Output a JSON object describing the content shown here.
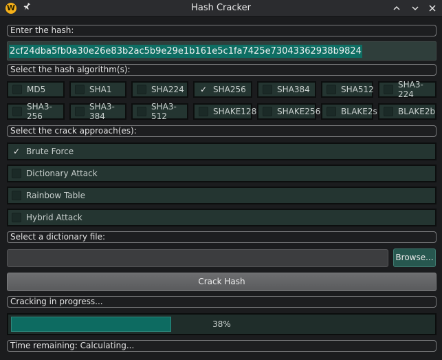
{
  "window": {
    "title": "Hash Cracker",
    "logo_letter": "W"
  },
  "hash_section": {
    "label": "Enter the hash:",
    "value": "2cf24dba5fb0a30e26e83b2ac5b9e29e1b161e5c1fa7425e73043362938b9824"
  },
  "algo_section": {
    "label": "Select the hash algorithm(s):",
    "row1": [
      {
        "label": "MD5",
        "checked": false
      },
      {
        "label": "SHA1",
        "checked": false
      },
      {
        "label": "SHA224",
        "checked": false
      },
      {
        "label": "SHA256",
        "checked": true
      },
      {
        "label": "SHA384",
        "checked": false
      },
      {
        "label": "SHA512",
        "checked": false
      },
      {
        "label": "SHA3-224",
        "checked": false
      }
    ],
    "row2": [
      {
        "label": "SHA3-256",
        "checked": false
      },
      {
        "label": "SHA3-384",
        "checked": false
      },
      {
        "label": "SHA3-512",
        "checked": false
      },
      {
        "label": "SHAKE128",
        "checked": false
      },
      {
        "label": "SHAKE256",
        "checked": false
      },
      {
        "label": "BLAKE2s",
        "checked": false
      },
      {
        "label": "BLAKE2b",
        "checked": false
      }
    ]
  },
  "approach_section": {
    "label": "Select the crack approach(es):",
    "items": [
      {
        "label": "Brute Force",
        "checked": true
      },
      {
        "label": "Dictionary Attack",
        "checked": false
      },
      {
        "label": "Rainbow Table",
        "checked": false
      },
      {
        "label": "Hybrid Attack",
        "checked": false
      }
    ]
  },
  "dictionary": {
    "label": "Select a dictionary file:",
    "value": "",
    "browse_label": "Browse..."
  },
  "crack_button_label": "Crack Hash",
  "status": {
    "progress_label": "Cracking in progress...",
    "progress_value": 0.38,
    "progress_text": "38%",
    "time_remaining": "Time remaining: Calculating..."
  },
  "colors": {
    "accent": "#0d6b61",
    "panel": "#243531",
    "logo": "#f5b019"
  },
  "icons": {
    "logo": "app-logo-icon",
    "pin": "pin-icon",
    "minimize": "chevron-up-icon",
    "maximize": "chevron-down-icon",
    "close": "close-icon",
    "check": "checkmark-icon"
  }
}
